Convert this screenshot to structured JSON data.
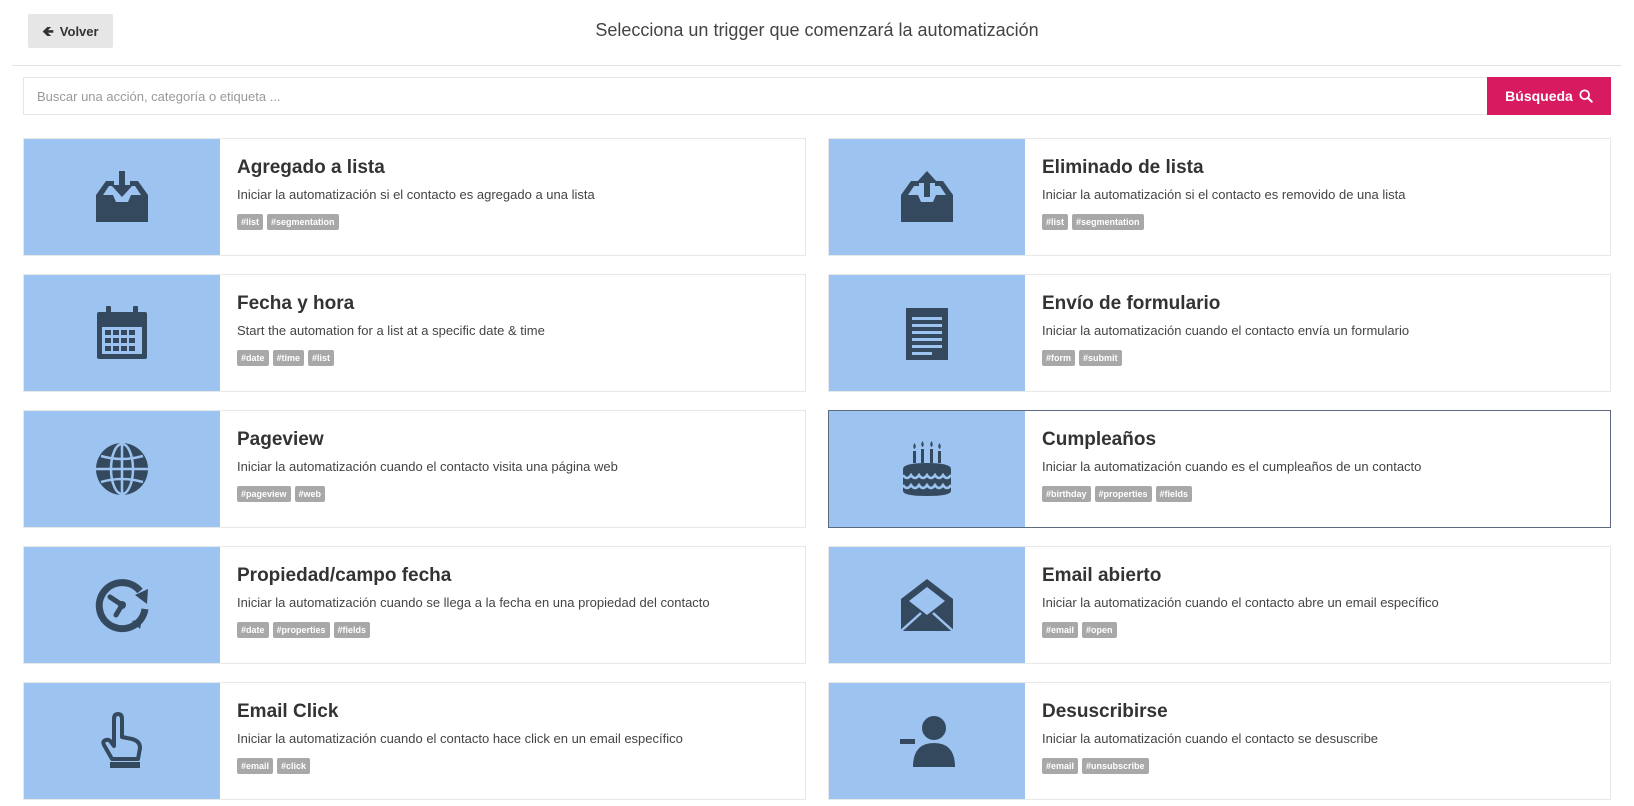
{
  "header": {
    "back_label": "Volver",
    "title": "Selecciona un trigger que comenzará la automatización"
  },
  "search": {
    "placeholder": "Buscar una acción, categoría o etiqueta ...",
    "button_label": "Búsqueda"
  },
  "colors": {
    "accent": "#d81b60",
    "icon_panel": "#9dc3f1",
    "icon_fill": "#34495e",
    "tag_bg": "#a8a8a8"
  },
  "triggers": [
    {
      "icon": "inbox-download-icon",
      "title": "Agregado a lista",
      "description": "Iniciar la automatización si el contacto es agregado a una lista",
      "tags": [
        "#list",
        "#segmentation"
      ]
    },
    {
      "icon": "inbox-upload-icon",
      "title": "Eliminado de lista",
      "description": "Iniciar la automatización si el contacto es removido de una lista",
      "tags": [
        "#list",
        "#segmentation"
      ]
    },
    {
      "icon": "calendar-icon",
      "title": "Fecha y hora",
      "description": "Start the automation for a list at a specific date & time",
      "tags": [
        "#date",
        "#time",
        "#list"
      ]
    },
    {
      "icon": "form-icon",
      "title": "Envío de formulario",
      "description": "Iniciar la automatización cuando el contacto envía un formulario",
      "tags": [
        "#form",
        "#submit"
      ]
    },
    {
      "icon": "globe-icon",
      "title": "Pageview",
      "description": "Iniciar la automatización cuando el contacto visita una página web",
      "tags": [
        "#pageview",
        "#web"
      ]
    },
    {
      "icon": "birthday-cake-icon",
      "title": "Cumpleaños",
      "description": "Iniciar la automatización cuando es el cumpleaños de un contacto",
      "tags": [
        "#birthday",
        "#properties",
        "#fields"
      ],
      "selected": true
    },
    {
      "icon": "clock-refresh-icon",
      "title": "Propiedad/campo fecha",
      "description": "Iniciar la automatización cuando se llega a la fecha en una propiedad del contacto",
      "tags": [
        "#date",
        "#properties",
        "#fields"
      ]
    },
    {
      "icon": "envelope-open-icon",
      "title": "Email abierto",
      "description": "Iniciar la automatización cuando el contacto abre un email específico",
      "tags": [
        "#email",
        "#open"
      ]
    },
    {
      "icon": "hand-pointer-icon",
      "title": "Email Click",
      "description": "Iniciar la automatización cuando el contacto hace click en un email específico",
      "tags": [
        "#email",
        "#click"
      ]
    },
    {
      "icon": "user-remove-icon",
      "title": "Desuscribirse",
      "description": "Iniciar la automatización cuando el contacto se desuscribe",
      "tags": [
        "#email",
        "#unsubscribe"
      ]
    }
  ]
}
